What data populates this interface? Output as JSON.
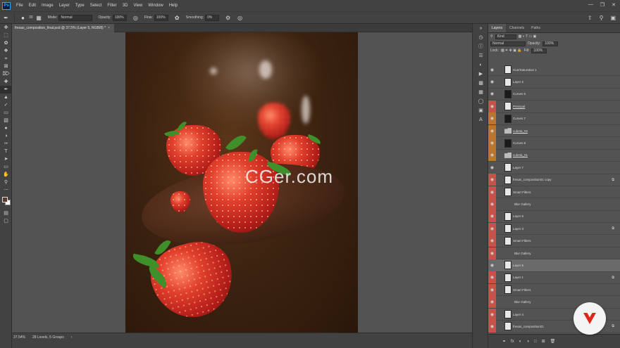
{
  "menu": {
    "app_logo": "Ps",
    "items": [
      "File",
      "Edit",
      "Image",
      "Layer",
      "Type",
      "Select",
      "Filter",
      "3D",
      "View",
      "Window",
      "Help"
    ]
  },
  "options": {
    "brush_size": "30",
    "mode_label": "Mode:",
    "mode_value": "Normal",
    "opacity_label": "Opacity:",
    "opacity_value": "100%",
    "flow_label": "Flow:",
    "flow_value": "100%",
    "smoothing_label": "Smoothing:",
    "smoothing_value": "0%"
  },
  "document": {
    "tab_title": "fresas_composition_final.psd @ 37.5% (Layer 5, RGB/8) *",
    "watermark": "CGer.com"
  },
  "status": {
    "zoom": "37.54%",
    "info": "28 Levels, 5 Groups"
  },
  "panel": {
    "tabs": [
      "Layers",
      "Channels",
      "Paths"
    ],
    "kind_label": "Kind",
    "blend_value": "Normal",
    "opacity_label": "Opacity:",
    "opacity_value": "100%",
    "lock_label": "Lock:",
    "fill_label": "Fill:",
    "fill_value": "100%"
  },
  "layers": [
    {
      "name": "Hue/Saturation 1",
      "eye": "none",
      "thumb": "light"
    },
    {
      "name": "Layer 2",
      "eye": "none",
      "thumb": "light"
    },
    {
      "name": "Curves 6",
      "eye": "none",
      "thumb": "dark"
    },
    {
      "name": "Principal",
      "eye": "red",
      "thumb": "light",
      "underline": true
    },
    {
      "name": "Curves 7",
      "eye": "orange",
      "thumb": "dark"
    },
    {
      "name": "cubeta_02",
      "eye": "orange",
      "thumb": "folder",
      "underline": true
    },
    {
      "name": "Curves 8",
      "eye": "orange",
      "thumb": "dark"
    },
    {
      "name": "cubeta_01",
      "eye": "orange",
      "thumb": "folder",
      "underline": true
    },
    {
      "name": "Layer 7",
      "eye": "none",
      "thumb": "light"
    },
    {
      "name": "fresas_composition01 copy",
      "eye": "red",
      "thumb": "light",
      "fx": true
    },
    {
      "name": "Smart Filters",
      "eye": "red",
      "thumb": "light"
    },
    {
      "name": "Blur Gallery",
      "eye": "red",
      "thumb": "none"
    },
    {
      "name": "Layer 6",
      "eye": "red",
      "thumb": "light"
    },
    {
      "name": "Layer 3",
      "eye": "red",
      "thumb": "light",
      "fx": true
    },
    {
      "name": "Smart Filters",
      "eye": "red",
      "thumb": "light"
    },
    {
      "name": "Blur Gallery",
      "eye": "red",
      "thumb": "none"
    },
    {
      "name": "Layer 5",
      "eye": "none",
      "thumb": "light",
      "selected": true
    },
    {
      "name": "Layer 1",
      "eye": "red",
      "thumb": "light",
      "fx": true
    },
    {
      "name": "Smart Filters",
      "eye": "red",
      "thumb": "light"
    },
    {
      "name": "Blur Gallery",
      "eye": "red",
      "thumb": "none"
    },
    {
      "name": "Layer 4",
      "eye": "red",
      "thumb": "light"
    },
    {
      "name": "fresas_composition01",
      "eye": "red",
      "thumb": "light",
      "fx": true
    }
  ]
}
